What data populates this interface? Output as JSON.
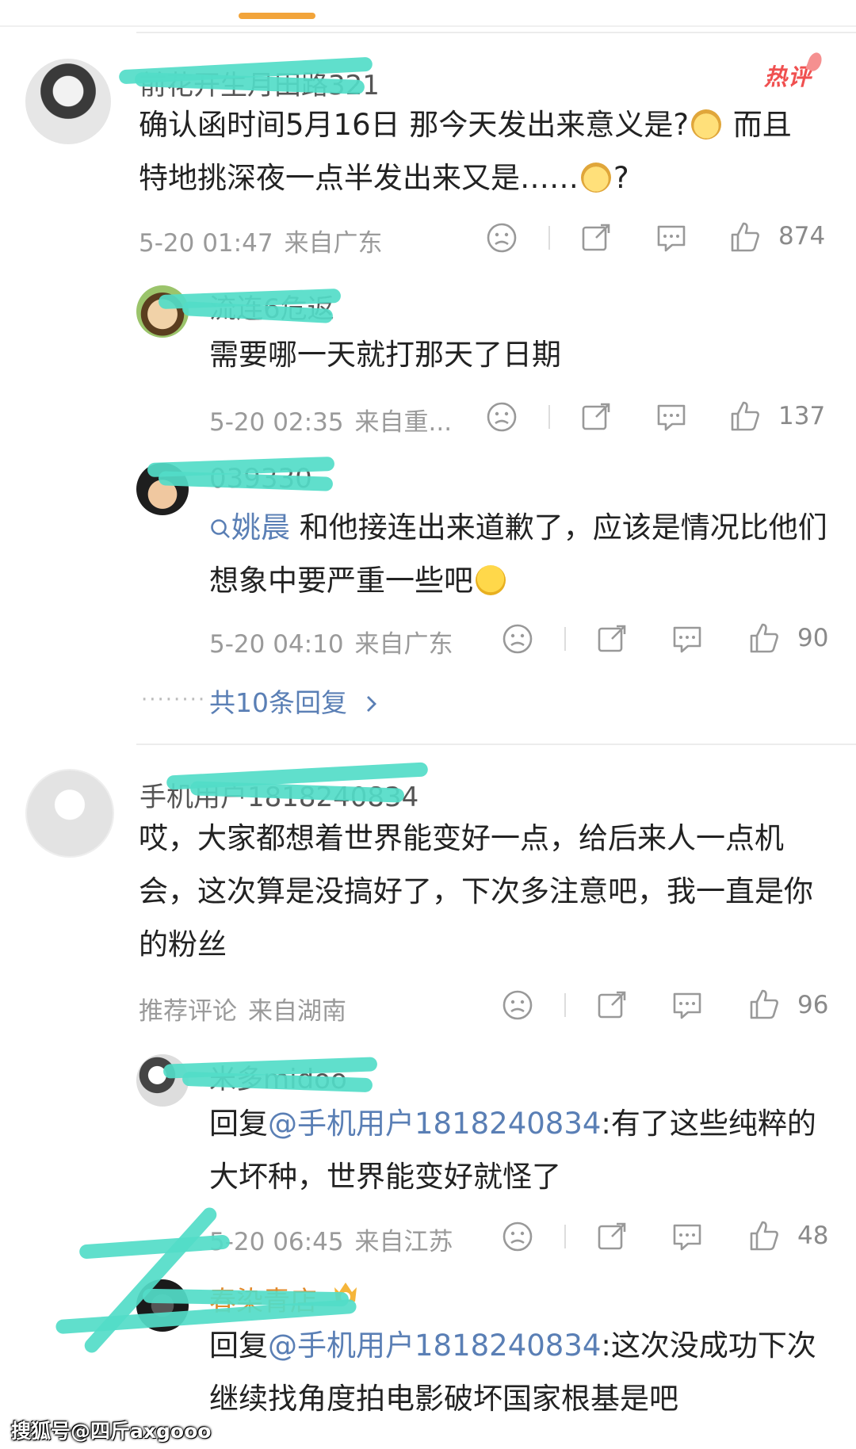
{
  "badge": {
    "hot": "热评"
  },
  "icons": [
    "dislike-icon",
    "share-icon",
    "comment-icon",
    "like-icon",
    "search-icon",
    "chevron-right-icon"
  ],
  "comments": [
    {
      "username": "前花开生月田路321",
      "text_pre": "确认函时间5月16日 那今天发出来意义是?",
      "text_mid": " 而且特地挑深夜一点半发出来又是……",
      "text_post": "?",
      "time": "5-20 01:47",
      "location": "来自广东",
      "likes": "874"
    },
    {
      "username": "流连6危返",
      "text": "需要哪一天就打那天了日期",
      "time": "5-20 02:35",
      "location": "来自重...",
      "likes": "137"
    },
    {
      "username": "039330",
      "mention": "姚晨",
      "text": " 和他接连出来道歉了，应该是情况比他们想象中要严重一些吧",
      "time": "5-20 04:10",
      "location": "来自广东",
      "likes": "90"
    },
    {
      "more_replies": "共10条回复"
    },
    {
      "username": "手机用户1818240834",
      "text": "哎，大家都想着世界能变好一点，给后来人一点机会，这次算是没搞好了，下次多注意吧，我一直是你的粉丝",
      "tag": "推荐评论",
      "location": "来自湖南",
      "likes": "96"
    },
    {
      "username": "米多midoo",
      "reply_prefix": "回复",
      "mention": "@手机用户1818240834",
      "text": ":有了这些纯粹的大坏种，世界能变好就怪了",
      "time": "5-20 06:45",
      "location": "来自江苏",
      "likes": "48"
    },
    {
      "username": "春染青店",
      "reply_prefix": "回复",
      "mention": "@手机用户1818240834",
      "text": ":这次没成功下次继续找角度拍电影破坏国家根基是吧"
    }
  ],
  "watermark": "搜狐号@四斤axgooo"
}
